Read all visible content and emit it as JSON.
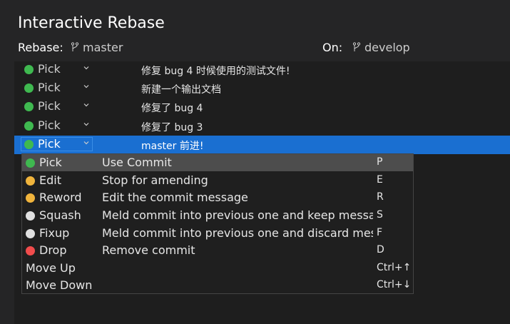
{
  "title": "Interactive Rebase",
  "rebase": {
    "label": "Rebase:",
    "branch": "master",
    "icon": "git-branch-icon"
  },
  "on": {
    "label": "On:",
    "branch": "develop",
    "icon": "git-branch-icon"
  },
  "chevron_icon": "chevron-down-icon",
  "commits": [
    {
      "action": "Pick",
      "color": "#3fb950",
      "message": "修复 bug 4 时候使用的测试文件!"
    },
    {
      "action": "Pick",
      "color": "#3fb950",
      "message": "新建一个输出文档"
    },
    {
      "action": "Pick",
      "color": "#3fb950",
      "message": "修复了 bug 4"
    },
    {
      "action": "Pick",
      "color": "#3fb950",
      "message": "修复了 bug 3"
    },
    {
      "action": "Pick",
      "color": "#3fb950",
      "message": "master 前进!",
      "selected": true
    }
  ],
  "dropdown": {
    "options": [
      {
        "name": "Pick",
        "color": "#3fb950",
        "description": "Use Commit",
        "key": "P",
        "active": true
      },
      {
        "name": "Edit",
        "color": "#f0b43c",
        "description": "Stop for amending",
        "key": "E"
      },
      {
        "name": "Reword",
        "color": "#f0b43c",
        "description": "Edit the commit message",
        "key": "R"
      },
      {
        "name": "Squash",
        "color": "#e0e0e0",
        "description": "Meld commit into previous one and keep message",
        "key": "S"
      },
      {
        "name": "Fixup",
        "color": "#e0e0e0",
        "description": "Meld commit into previous one and discard message",
        "key": "F"
      },
      {
        "name": "Drop",
        "color": "#f14c4c",
        "description": "Remove commit",
        "key": "D"
      },
      {
        "name": "Move Up",
        "description": "",
        "key": "Ctrl+↑"
      },
      {
        "name": "Move Down",
        "description": "",
        "key": "Ctrl+↓"
      }
    ]
  }
}
